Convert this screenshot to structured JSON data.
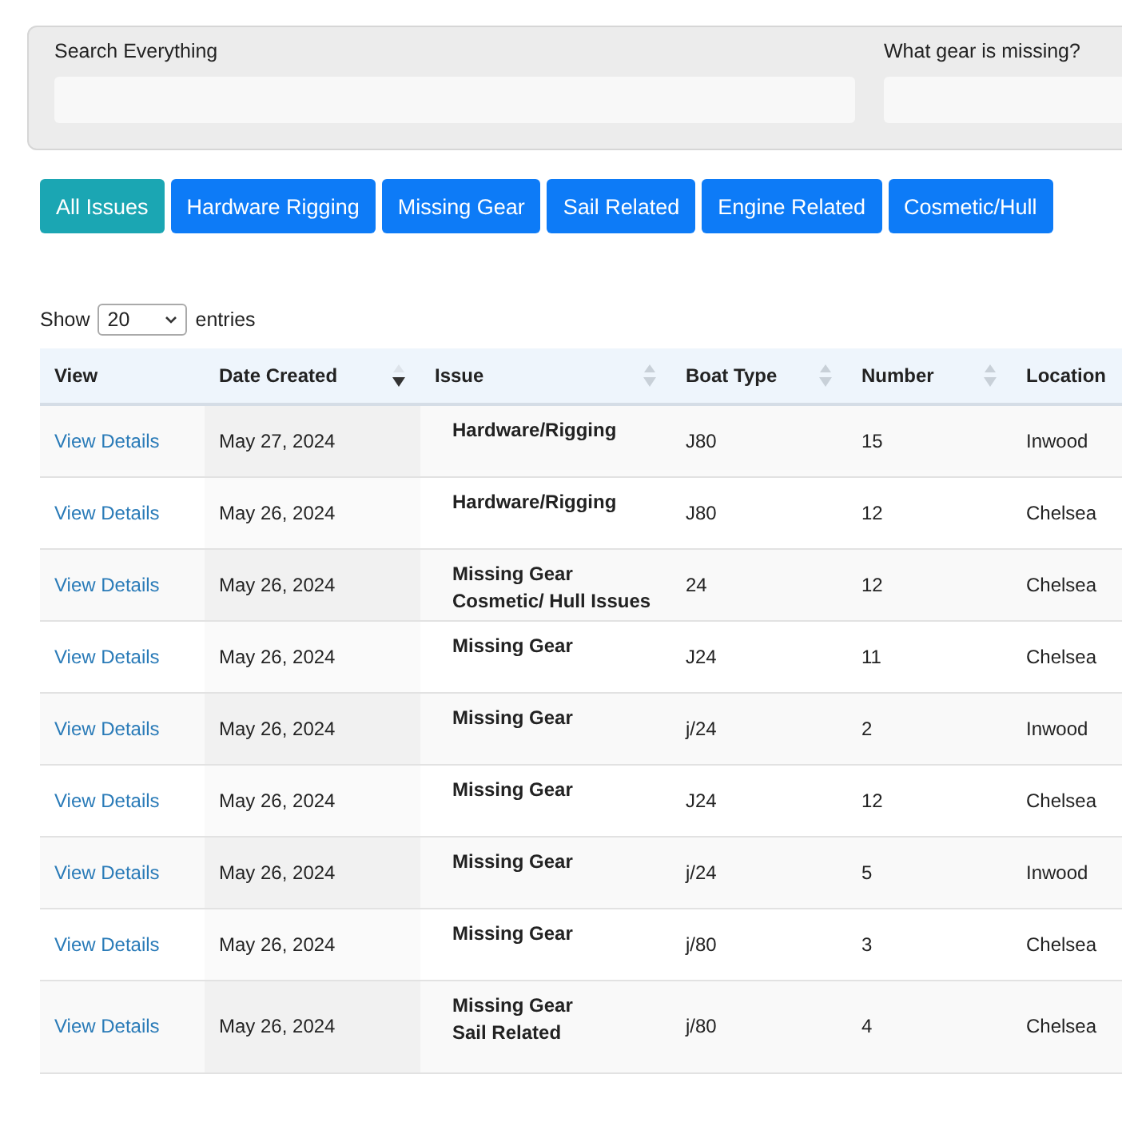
{
  "filters": [
    {
      "label": "Search Everything"
    },
    {
      "label": "What gear is missing?"
    }
  ],
  "categories": [
    {
      "label": "All Issues",
      "selected": true
    },
    {
      "label": "Hardware Rigging",
      "selected": false
    },
    {
      "label": "Missing Gear",
      "selected": false
    },
    {
      "label": "Sail Related",
      "selected": false
    },
    {
      "label": "Engine Related",
      "selected": false
    },
    {
      "label": "Cosmetic/Hull",
      "selected": false
    }
  ],
  "entries": {
    "before": "Show",
    "value": "20",
    "after": "entries"
  },
  "table": {
    "columns": [
      {
        "label": "View",
        "sortable": false
      },
      {
        "label": "Date Created",
        "sortable": true,
        "sorted_desc": true
      },
      {
        "label": "Issue",
        "sortable": true,
        "sorted_desc": false
      },
      {
        "label": "Boat Type",
        "sortable": true,
        "sorted_desc": false
      },
      {
        "label": "Number",
        "sortable": true,
        "sorted_desc": false
      },
      {
        "label": "Location",
        "sortable": false
      }
    ],
    "rows": [
      {
        "link": "View Details",
        "date": "May 27, 2024",
        "issues": [
          "Hardware/Rigging"
        ],
        "boat_type": "J80",
        "number": "15",
        "location": "Inwood"
      },
      {
        "link": "View Details",
        "date": "May 26, 2024",
        "issues": [
          "Hardware/Rigging"
        ],
        "boat_type": "J80",
        "number": "12",
        "location": "Chelsea"
      },
      {
        "link": "View Details",
        "date": "May 26, 2024",
        "issues": [
          "Missing Gear",
          "Cosmetic/ Hull Issues"
        ],
        "boat_type": "24",
        "number": "12",
        "location": "Chelsea"
      },
      {
        "link": "View Details",
        "date": "May 26, 2024",
        "issues": [
          "Missing Gear"
        ],
        "boat_type": "J24",
        "number": "11",
        "location": "Chelsea"
      },
      {
        "link": "View Details",
        "date": "May 26, 2024",
        "issues": [
          "Missing Gear"
        ],
        "boat_type": "j/24",
        "number": "2",
        "location": "Inwood"
      },
      {
        "link": "View Details",
        "date": "May 26, 2024",
        "issues": [
          "Missing Gear"
        ],
        "boat_type": "J24",
        "number": "12",
        "location": "Chelsea"
      },
      {
        "link": "View Details",
        "date": "May 26, 2024",
        "issues": [
          "Missing Gear"
        ],
        "boat_type": "j/24",
        "number": "5",
        "location": "Inwood"
      },
      {
        "link": "View Details",
        "date": "May 26, 2024",
        "issues": [
          "Missing Gear"
        ],
        "boat_type": "j/80",
        "number": "3",
        "location": "Chelsea"
      },
      {
        "link": "View Details",
        "date": "May 26, 2024",
        "issues": [
          "Missing Gear",
          "Sail Related"
        ],
        "boat_type": "j/80",
        "number": "4",
        "location": "Chelsea"
      }
    ]
  }
}
